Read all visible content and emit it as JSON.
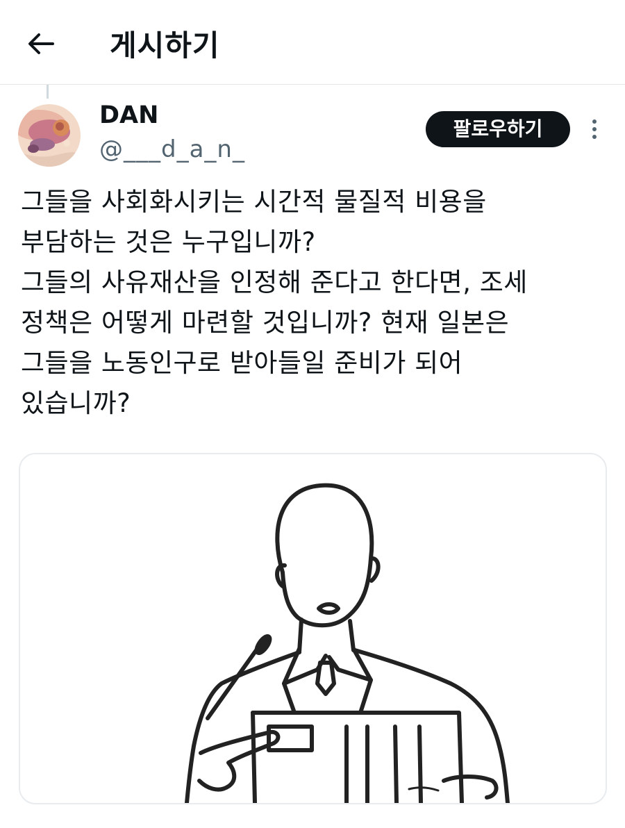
{
  "header": {
    "title": "게시하기",
    "back_icon": "arrow-left-icon"
  },
  "tweet": {
    "author": {
      "name": "DAN",
      "handle": "@___d_a_n_"
    },
    "follow_label": "팔로우하기",
    "more_icon": "more-vertical-icon",
    "text": "그들을 사회화시키는 시간적 물질적 비용을\n부담하는 것은 누구입니까?\n그들의 사유재산을 인정해 준다고 한다면, 조세\n정책은 어떻게 마련할 것입니까? 현재 일본은\n그들을 노동인구로 받아들일 준비가 되어\n있습니까?",
    "media": {
      "type": "image",
      "description_icon": "speaker-at-podium-drawing"
    }
  },
  "colors": {
    "text": "#0f1419",
    "secondary": "#536471",
    "follow_bg": "#0f1419",
    "follow_text": "#ffffff",
    "divider": "#e6e6e6"
  }
}
